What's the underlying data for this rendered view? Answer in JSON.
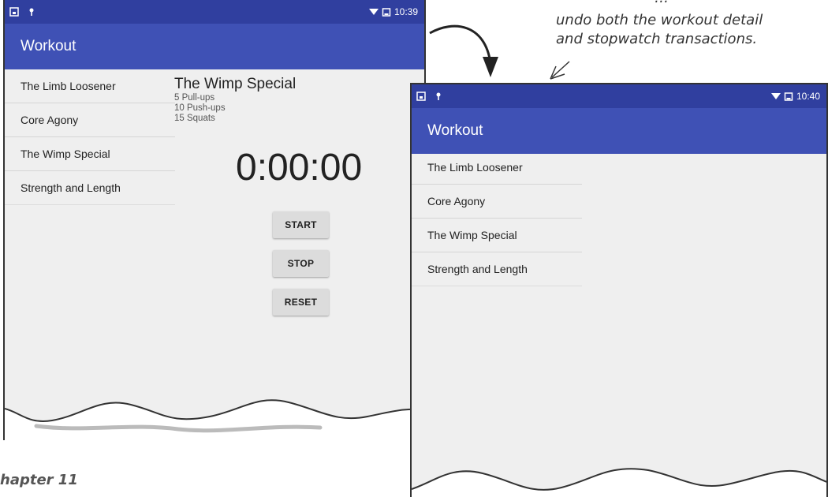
{
  "annotation": {
    "line0": "...",
    "line1": "undo both the workout detail",
    "line2": "and stopwatch transactions."
  },
  "caption": "hapter 11",
  "left_screen": {
    "status_time": "10:39",
    "app_title": "Workout",
    "list_items": [
      "The Limb Loosener",
      "Core Agony",
      "The Wimp Special",
      "Strength and Length"
    ],
    "detail": {
      "title": "The Wimp Special",
      "lines": [
        "5 Pull-ups",
        "10 Push-ups",
        "15 Squats"
      ]
    },
    "timer": "0:00:00",
    "buttons": {
      "start": "START",
      "stop": "STOP",
      "reset": "RESET"
    }
  },
  "right_screen": {
    "status_time": "10:40",
    "app_title": "Workout",
    "list_items": [
      "The Limb Loosener",
      "Core Agony",
      "The Wimp Special",
      "Strength and Length"
    ]
  },
  "colors": {
    "statusbar": "#303f9f",
    "appbar": "#3f51b5",
    "background": "#efefef"
  }
}
